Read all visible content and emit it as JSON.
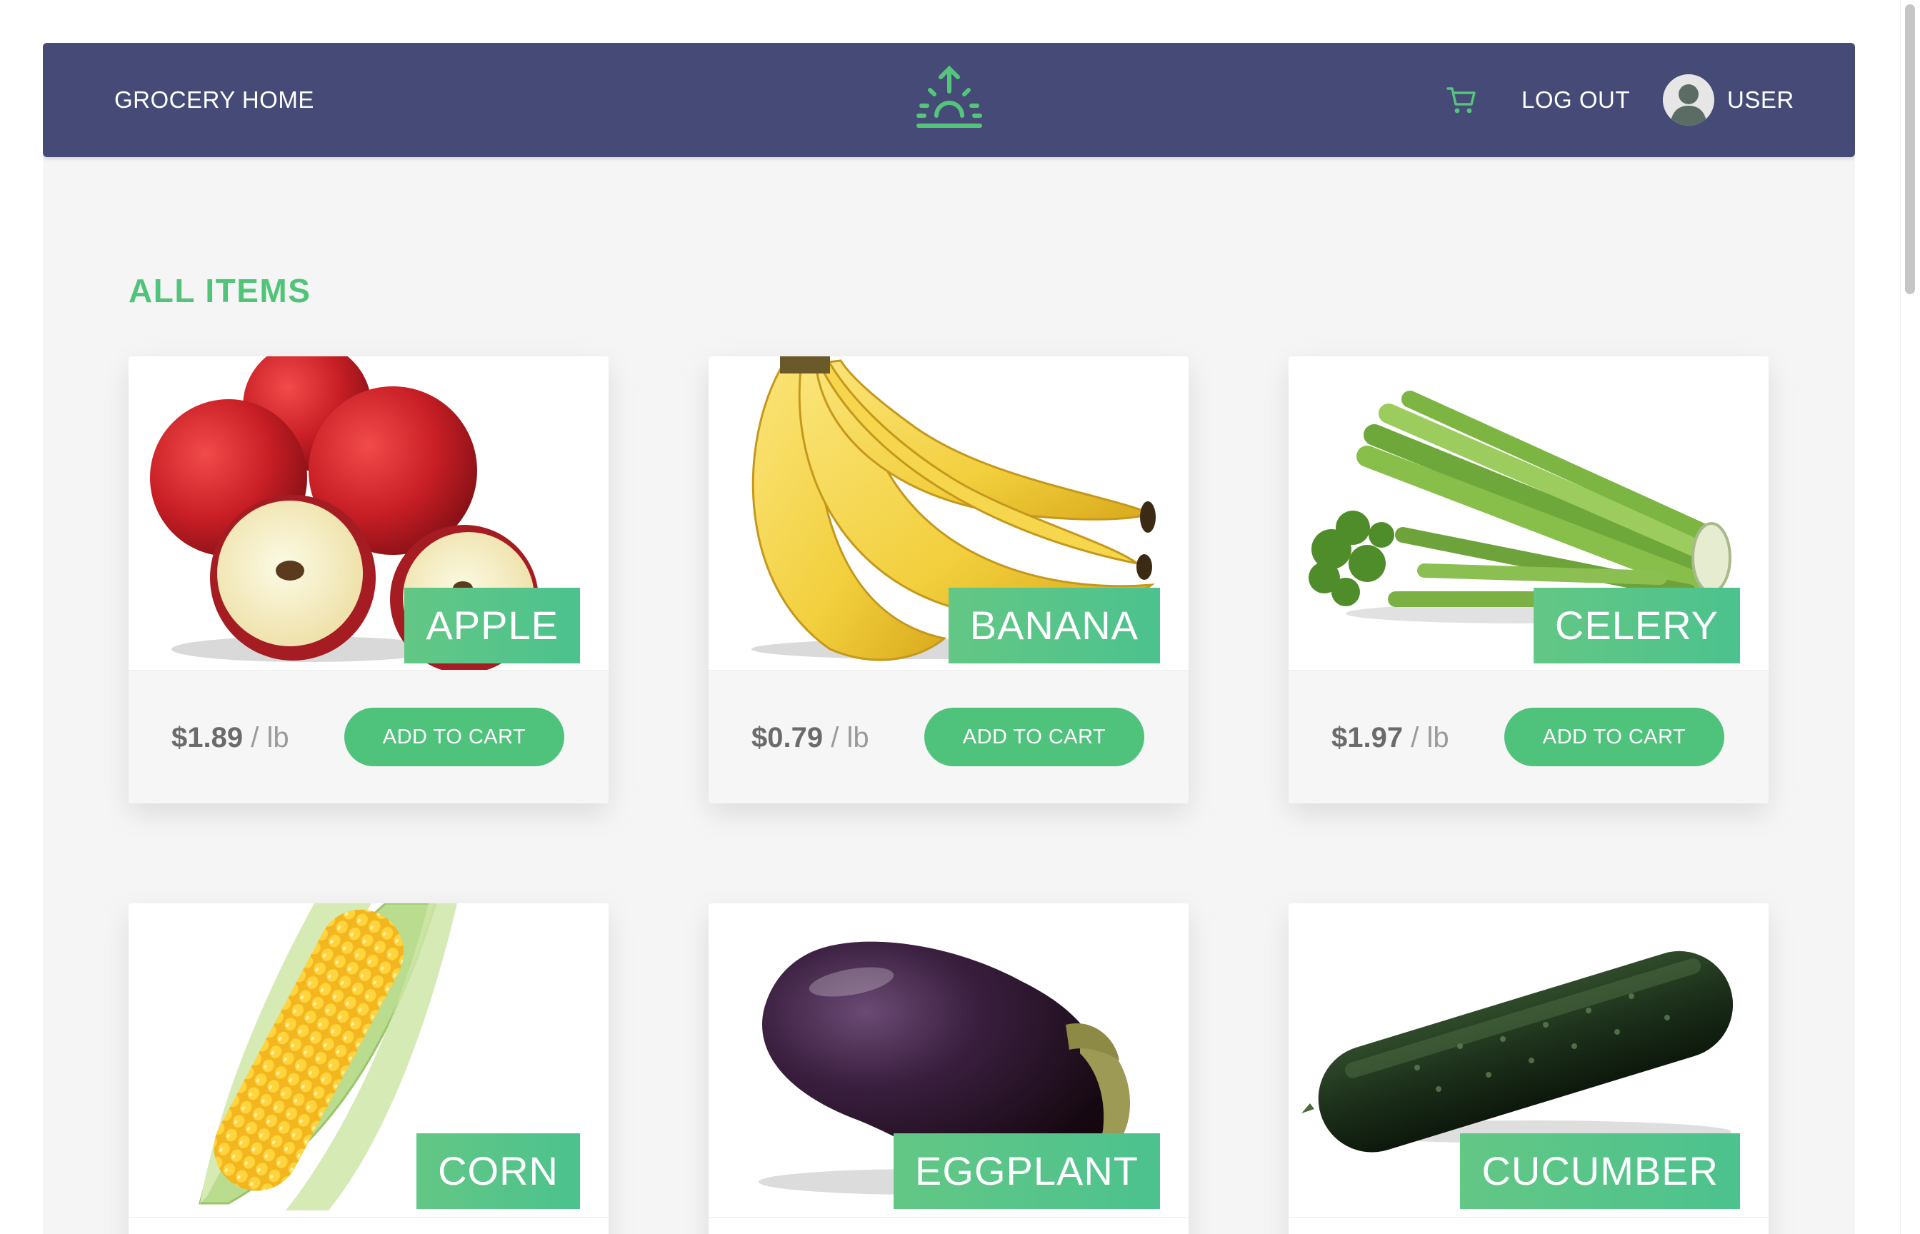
{
  "header": {
    "brand": "GROCERY HOME",
    "logo_icon": "sunrise-arrow-icon",
    "cart_icon": "cart-icon",
    "logout": "LOG OUT",
    "user": "USER",
    "avatar_icon": "user-avatar-icon",
    "background_color": "#454a77",
    "accent_color": "#52c47a"
  },
  "main": {
    "section_title": "ALL ITEMS",
    "items": [
      {
        "name": "APPLE",
        "price": "$1.89",
        "unit": "/ lb",
        "button": "ADD TO CART",
        "image_icon": "apple-image"
      },
      {
        "name": "BANANA",
        "price": "$0.79",
        "unit": "/ lb",
        "button": "ADD TO CART",
        "image_icon": "banana-image"
      },
      {
        "name": "CELERY",
        "price": "$1.97",
        "unit": "/ lb",
        "button": "ADD TO CART",
        "image_icon": "celery-image"
      },
      {
        "name": "CORN",
        "image_icon": "corn-image"
      },
      {
        "name": "EGGPLANT",
        "image_icon": "eggplant-image"
      },
      {
        "name": "CUCUMBER",
        "image_icon": "cucumber-image"
      }
    ]
  }
}
